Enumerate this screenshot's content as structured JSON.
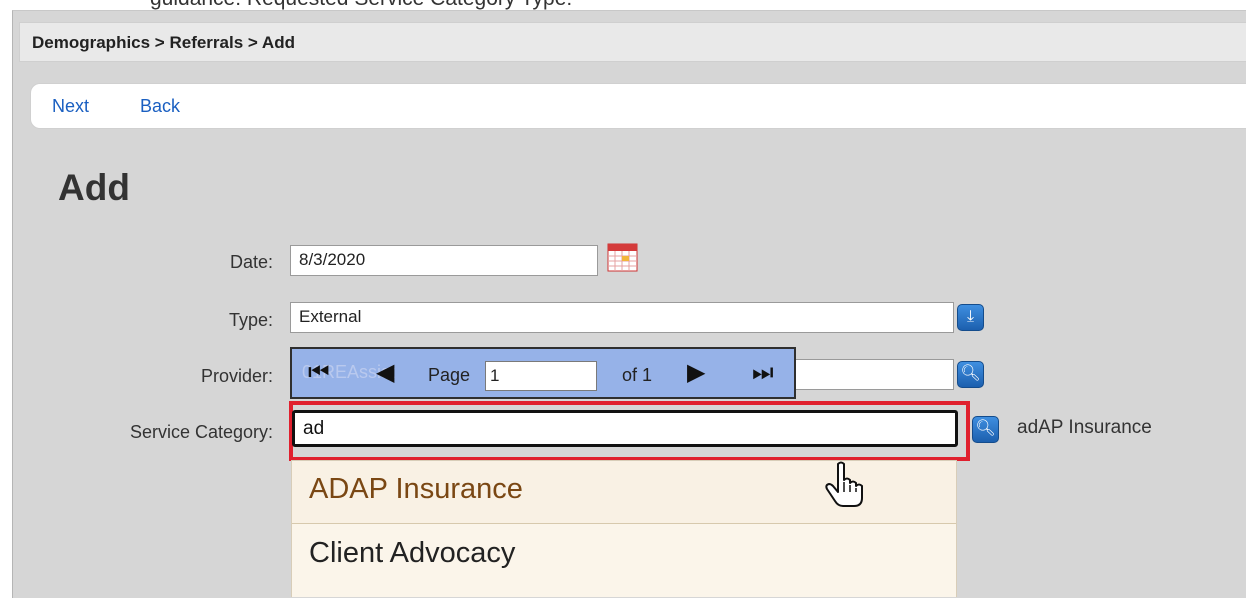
{
  "doc_line": "guidance: Requested Service Category Type:",
  "breadcrumb": "Demographics > Referrals > Add",
  "nav": {
    "next": "Next",
    "back": "Back"
  },
  "page_title": "Add",
  "form": {
    "date": {
      "label": "Date:",
      "value": "8/3/2020"
    },
    "type": {
      "label": "Type:",
      "value": "External"
    },
    "provider": {
      "label": "Provider:",
      "value": "01REAssist"
    },
    "service_category": {
      "label": "Service Category:",
      "value": "ad",
      "result": "adAP Insurance"
    }
  },
  "pager": {
    "first_icon": "first-page-icon",
    "prev_icon": "prev-page-icon",
    "page_label": "Page",
    "page_value": "1",
    "of_label": "of 1",
    "next_icon": "next-page-icon",
    "last_icon": "last-page-icon"
  },
  "dropdown": [
    "ADAP Insurance",
    "Client Advocacy"
  ],
  "colors": {
    "highlight": "#e0202e",
    "link": "#1a5fc1",
    "pager_bg": "#96b2e8",
    "button": "#1c5fae"
  }
}
